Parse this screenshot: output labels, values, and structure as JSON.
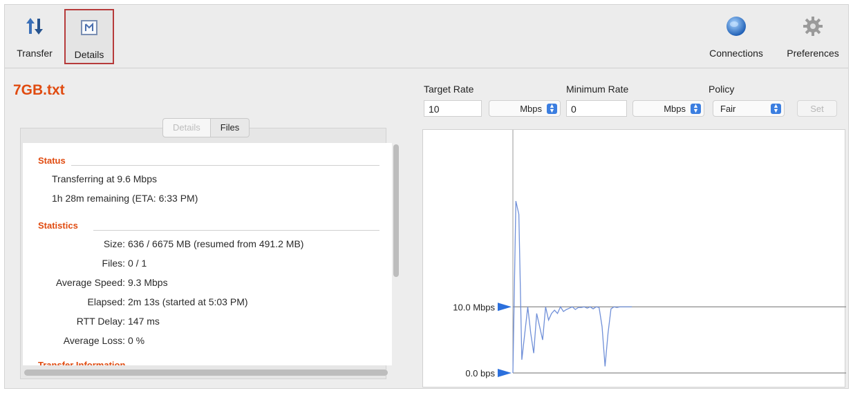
{
  "toolbar": {
    "transfer_label": "Transfer",
    "details_label": "Details",
    "connections_label": "Connections",
    "preferences_label": "Preferences"
  },
  "file": {
    "title": "7GB.txt"
  },
  "tabs": {
    "details": "Details",
    "files": "Files"
  },
  "status": {
    "heading": "Status",
    "line1": "Transferring at 9.6 Mbps",
    "line2": "1h 28m remaining (ETA: 6:33 PM)"
  },
  "statistics": {
    "heading": "Statistics",
    "rows": [
      {
        "key": "Size:",
        "value": "636 / 6675 MB (resumed from 491.2 MB)"
      },
      {
        "key": "Files:",
        "value": "0 / 1"
      },
      {
        "key": "Average Speed:",
        "value": "9.3 Mbps"
      },
      {
        "key": "Elapsed:",
        "value": "2m 13s (started at 5:03 PM)"
      },
      {
        "key": "RTT Delay:",
        "value": "147 ms"
      },
      {
        "key": "Average Loss:",
        "value": "0 %"
      }
    ]
  },
  "next_section_partial": "Transfer Information",
  "controls": {
    "target_rate_label": "Target Rate",
    "target_rate_value": "10",
    "target_unit": "Mbps",
    "minimum_rate_label": "Minimum Rate",
    "minimum_rate_value": "0",
    "minimum_unit": "Mbps",
    "policy_label": "Policy",
    "policy_value": "Fair",
    "set_label": "Set"
  },
  "colors": {
    "accent": "#e04b10",
    "graph_line": "#6f8fd8",
    "marker": "#2b6fdc"
  },
  "chart_data": {
    "type": "line",
    "y_markers": [
      {
        "label": "10.0 Mbps",
        "value": 10.0
      },
      {
        "label": "0.0 bps",
        "value": 0.0
      }
    ],
    "ylim": [
      0,
      28
    ],
    "x": [
      0,
      1,
      2,
      3,
      4,
      5,
      6,
      7,
      8,
      9,
      10,
      11,
      12,
      13,
      14,
      15,
      16,
      17,
      18,
      19,
      20,
      21,
      22,
      23,
      24,
      25,
      26,
      27,
      28,
      29,
      30,
      31,
      32,
      33,
      34,
      35,
      36,
      37,
      38,
      39,
      40
    ],
    "values": [
      0,
      26,
      24,
      2,
      6,
      10,
      6,
      3,
      9,
      7,
      5,
      10,
      8,
      9,
      9.5,
      9,
      10,
      9.3,
      9.6,
      9.8,
      10,
      9.6,
      9.9,
      9.9,
      10,
      9.8,
      10,
      9.7,
      10,
      9.9,
      7,
      1,
      6,
      9.7,
      10,
      9.9,
      10,
      10,
      10,
      10,
      10
    ]
  }
}
